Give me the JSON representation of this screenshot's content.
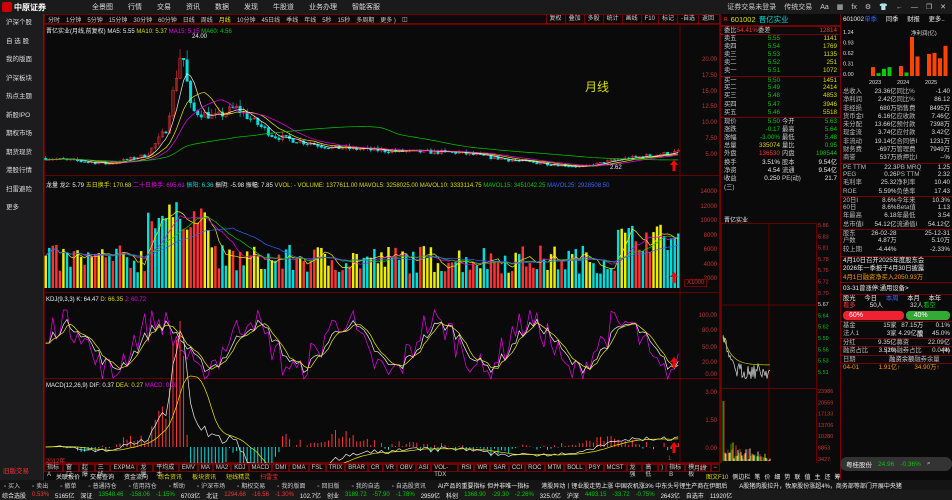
{
  "logo": "中原证券",
  "menu": [
    "全景图",
    "行情",
    "交易",
    "资讯",
    "数据",
    "发现",
    "牛股道",
    "业务办理",
    "智能客服"
  ],
  "window": {
    "login": "证券交易未登录",
    "classic": "传统交易"
  },
  "sidebar": [
    "沪深个股",
    "自 选 股",
    "我的版面",
    "沪深板块",
    "热点主题",
    "新股IPO",
    "期权市场",
    "期货现货",
    "港股行情",
    "扫雷避险",
    "更多"
  ],
  "old_trade": "旧版交易",
  "periods": [
    "分时",
    "1分钟",
    "5分钟",
    "15分钟",
    "30分钟",
    "60分钟",
    "日线",
    "周线",
    "月线",
    "10分钟",
    "45日线",
    "季线",
    "年线",
    "5秒",
    "15秒",
    "多周期",
    "更多 )"
  ],
  "active_period": "月线",
  "chart_buttons": [
    "复权",
    "叠加",
    "多股",
    "统计",
    "画线",
    "F10",
    "标记",
    "-自选",
    "返回"
  ],
  "price_header": {
    "name": "晋亿实业(月线,前复权)",
    "ma5": "MA5: 5.55",
    "ma10": "MA10: 5.37",
    "ma15": "MA15: 5.15",
    "ma60": "MA60: 4.56",
    "peak": "24.00",
    "low": "2.62",
    "watermark": "月线"
  },
  "price_axis": [
    "20.00",
    "17.50",
    "15.00",
    "12.50",
    "10.00",
    "7.50",
    "5.00"
  ],
  "vol_header": {
    "a": "龙量 龙2: 5.79",
    "b": "五日换手: 170.68",
    "c": "二十日换手: 695.61",
    "d": "振阳: 6.36",
    "e": "振阴: -5.98",
    "f": "振幅: 7.85",
    "g": "VVOL: - VOLUME: 1377611.00",
    "h": "MAVOL5: 3258025.00",
    "i": "MAVOL10: 3333114.75",
    "j": "MAVOL15: 3451042.25",
    "k": "MAVOL25: 2928508.50"
  },
  "vol_axis": [
    "14000",
    "12000",
    "10000",
    "8000",
    "6000",
    "4000",
    "2000"
  ],
  "vol_unit": "X1000",
  "kdj_header": {
    "name": "KDJ(9,3,3) K: 64.47",
    "d": "D: 66.35",
    "j": "J: 60.72"
  },
  "kdj_axis": [
    "100.00",
    "80.00",
    "50.00",
    "20.00",
    "0.00"
  ],
  "macd_header": {
    "name": "MACD(12,26,9) DIF: 0.37",
    "dea": "DEA: 0.27",
    "macd": "MACD: 0.20"
  },
  "macd_axis": [
    "3.00",
    "1.50",
    "0.00"
  ],
  "x_axis": {
    "start": "2012年",
    "end": "1",
    "period": "月线"
  },
  "stock": {
    "code": "601002",
    "name": "晋亿实业",
    "weibi_l": "委比",
    "weibi": "54.41%",
    "weicha_l": "委差",
    "weicha": "12814"
  },
  "asks": [
    [
      "卖五",
      "5.55",
      "1141"
    ],
    [
      "卖四",
      "5.54",
      "1769"
    ],
    [
      "卖三",
      "5.53",
      "1135"
    ],
    [
      "卖二",
      "5.52",
      "251"
    ],
    [
      "卖一",
      "5.51",
      "1072"
    ]
  ],
  "bids": [
    [
      "买一",
      "5.50",
      "1451"
    ],
    [
      "买二",
      "5.49",
      "2414"
    ],
    [
      "买三",
      "5.48",
      "4853"
    ],
    [
      "买四",
      "5.47",
      "3946"
    ],
    [
      "买五",
      "5.46",
      "5518"
    ]
  ],
  "stats": [
    [
      "现价",
      "5.50",
      "今开",
      "5.63"
    ],
    [
      "涨跌",
      "-0.17",
      "最高",
      "5.64"
    ],
    [
      "涨幅",
      "-3.00%",
      "最低",
      "5.48"
    ],
    [
      "总量",
      "335074",
      "量比",
      "0.95"
    ],
    [
      "外盘",
      "136530",
      "内盘",
      "198544"
    ],
    [
      "换手",
      "3.51%",
      "股本",
      "9.54亿"
    ],
    [
      "净资",
      "4.54",
      "流通",
      "9.54亿"
    ],
    [
      "收益(三)",
      "0.250",
      "PE(动)",
      "21.7"
    ]
  ],
  "mini": {
    "title": "晋亿实业",
    "price_axis": [
      "5.86",
      "5.83",
      "5.81",
      "5.78",
      "5.75",
      "5.72",
      "5.70",
      "5.67",
      "5.64",
      "5.62",
      "5.59",
      "5.56",
      "5.53",
      "5.51"
    ],
    "vol_axis": [
      "23986",
      "20559",
      "17133",
      "13706",
      "10280",
      "6853",
      "3427"
    ]
  },
  "fin": {
    "code": "601002",
    "tabs": [
      "单季",
      "同季",
      "财报",
      "更多.."
    ],
    "chart_label": "净利润(亿)",
    "yaxis": [
      "1.24",
      "0.93",
      "0.62",
      "0.31",
      "0.00"
    ],
    "years": [
      "2023",
      "2024",
      "2025"
    ],
    "bars": [
      0.25,
      0.08,
      0.2,
      0.25,
      0.28,
      0.1,
      1.1,
      0.55,
      0.62,
      0.65,
      0.5,
      0.85
    ],
    "rows": [
      [
        "总收入",
        "23.36亿",
        "同比%",
        "-1.40"
      ],
      [
        "净利润",
        "2.42亿",
        "同比%",
        "86.12"
      ],
      [
        "非经损",
        "680万",
        "销售费",
        "8495万"
      ],
      [
        "货币金Ⅰ",
        "6.16亿",
        "应收款",
        "7.46亿"
      ],
      [
        "未分配",
        "13.66亿",
        "预付款",
        "7398万"
      ],
      [
        "现金流",
        "3.74亿",
        "应付款",
        "3.42亿"
      ],
      [
        "非流动",
        "19.14亿",
        "合同债Ⅰ",
        "1231万"
      ],
      [
        "财务费",
        "-697万",
        "管理费",
        "7949万"
      ],
      [
        "商誉",
        "537万",
        "质押比Ⅰ",
        "--%"
      ],
      [
        "PE TTM",
        "22.3",
        "PB MRQ",
        "1.25"
      ],
      [
        "PEG",
        "0.26",
        "PS TTM",
        "2.32"
      ],
      [
        "毛利率",
        "25.32",
        "净利率",
        "10.40"
      ],
      [
        "ROE",
        "5.59%",
        "负债率",
        "17.43"
      ],
      [
        "20日Ⅰ",
        "8.6%",
        "今年来",
        "10.3%"
      ],
      [
        "60日",
        "8.6%",
        "Beta值",
        "1.13"
      ],
      [
        "年最高",
        "6.18",
        "年最低",
        "3.54"
      ],
      [
        "总市值Ⅰ",
        "54.12亿",
        "流通值Ⅰ",
        "54.12亿"
      ],
      [
        "股东",
        "26-02-28",
        "",
        "25-12-31"
      ],
      [
        "户数",
        "4.87万",
        "",
        "5.10万"
      ],
      [
        "较上期",
        "-4.44%",
        "",
        "-2.33%"
      ]
    ],
    "news": [
      "4月10日召开2025年度股东会",
      "2026年一季报于4月30日披露",
      "4月1日融资净买入2050.93万"
    ],
    "limit": "03-31曾涨停:通用设备>",
    "sentiment": {
      "label": "股光",
      "tabs": [
        "今日",
        "本周",
        "本月",
        "本年"
      ],
      "bull": "看多",
      "bull_n": "50人",
      "bear_n": "32人",
      "bear": "看空",
      "bull_pct": "60%",
      "bear_pct": "40%",
      "bull_frac": 0.6
    },
    "holders": [
      [
        "基金",
        "15家",
        "87.15万股",
        "0.1%"
      ],
      [
        "法人1",
        "3家",
        "4.29亿股",
        "45.0%"
      ]
    ],
    "div": [
      "分红",
      "9.35亿(10)",
      "募资",
      "22.09亿(4)"
    ],
    "margin": [
      "融资占比",
      "3.52%",
      "融券占比",
      "0.04%"
    ],
    "margin_head": [
      "日期",
      "融资余额",
      "融券余量"
    ],
    "margin_row": [
      "04-01",
      "1.91亿↑",
      "34.90万↑"
    ]
  },
  "float_quote": {
    "name": "粤桂股份",
    "price": "24.96",
    "chg": "-0.36%"
  },
  "indicators": [
    "指标A",
    "窗口",
    "起爆",
    "三线",
    "EXPMA",
    "龙量",
    "平均成本",
    "EMV",
    "MA",
    "MA2",
    "KDJ",
    "MACD",
    "DMI",
    "DMA",
    "FSL",
    "TRIX",
    "BRAR",
    "CR",
    "VR",
    "OBV",
    "ASI",
    "VOL-TDX",
    "RSI",
    "WR",
    "SAR",
    "CCI",
    "ROC",
    "MTM",
    "BOLL",
    "PSY",
    "MCST",
    "龙强",
    "高低",
    ")",
    "指标B",
    "模板",
    "+",
    "−"
  ],
  "active_indicator": "MACD",
  "links": [
    [
      "关联报价",
      "wht"
    ],
    [
      "交易查询",
      "wht"
    ],
    [
      "资金流向",
      "wht"
    ],
    [
      "综合资讯",
      "yel"
    ],
    [
      "板块资讯",
      "yel"
    ],
    [
      "短线精灵",
      "yel"
    ],
    [
      "扫雷宝",
      "red"
    ]
  ],
  "side_tabs": [
    "图文F10",
    "侧边栏",
    "笔",
    "价",
    "细",
    "势",
    "联",
    "值",
    "主",
    "还",
    "筹"
  ],
  "toolbar": [
    "买入",
    "卖出",
    "撤单",
    "普通持仓",
    "信用持仓",
    "帮助",
    "沪深市场",
    "期权交易",
    "我的版面",
    "回旧版",
    "我的自选",
    "自选股资讯"
  ],
  "news_ticker": [
    "AI产品的重要指标 但并非唯一指标",
    "港股异动丨锂业股走势上涨 中国农机涨3% 中东头号锂生产商在伊朗后",
    "A股猪肉股拉升，牧原股份涨超4%，商务部等部门开展中央猪"
  ],
  "status": [
    [
      "综合选股",
      "wht"
    ],
    [
      "0.53%",
      "red"
    ],
    [
      "5165亿",
      "wht"
    ],
    [
      "深证",
      "wht"
    ],
    [
      "13548.46",
      "grn"
    ],
    [
      "-158.06",
      "grn"
    ],
    [
      "-1.15%",
      "grn"
    ],
    [
      "6703亿",
      "wht"
    ],
    [
      "北证",
      "wht"
    ],
    [
      "1294.68",
      "red"
    ],
    [
      "-16.56",
      "red"
    ],
    [
      "-1.30%",
      "red"
    ],
    [
      "102.7亿",
      "wht"
    ],
    [
      "创业",
      "wht"
    ],
    [
      "3189.72",
      "grn"
    ],
    [
      "-57.90",
      "grn"
    ],
    [
      "-1.78%",
      "grn"
    ],
    [
      "2959亿",
      "wht"
    ],
    [
      "科创",
      "wht"
    ],
    [
      "1368.90",
      "grn"
    ],
    [
      "-29.30",
      "grn"
    ],
    [
      "-2.26%",
      "grn"
    ],
    [
      "325.0亿",
      "wht"
    ],
    [
      "沪深",
      "wht"
    ],
    [
      "4493.15",
      "grn"
    ],
    [
      "-33.72",
      "grn"
    ],
    [
      "-0.75%",
      "grn"
    ],
    [
      "2643亿",
      "wht"
    ],
    [
      "自选市",
      "wht"
    ],
    [
      "11920亿",
      "wht"
    ]
  ]
}
